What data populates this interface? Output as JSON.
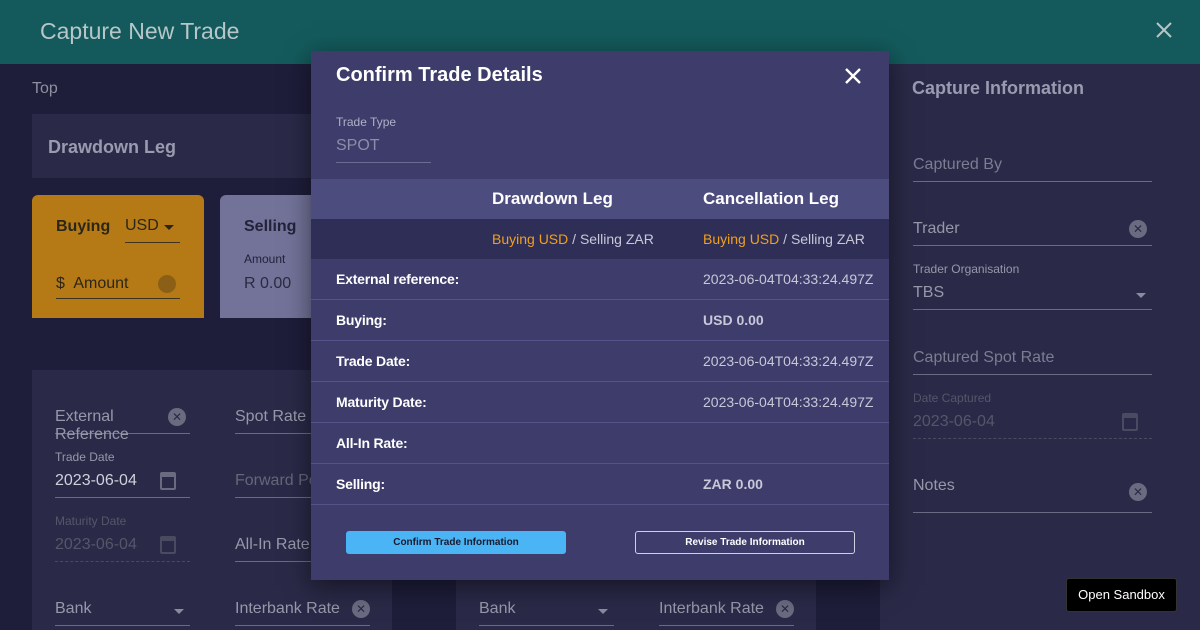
{
  "header": {
    "title": "Capture New Trade"
  },
  "background": {
    "top_label": "Top",
    "drawdown_title": "Drawdown Leg",
    "buy": {
      "label": "Buying",
      "currency": "USD",
      "amount_prefix": "$",
      "amount_placeholder": "Amount"
    },
    "sell": {
      "label": "Selling",
      "amount_label": "Amount",
      "amount_prefix": "R",
      "amount_value": "0.00"
    },
    "form": {
      "external_reference": "External Reference",
      "spot_rate": "Spot Rate",
      "trade_date_label": "Trade Date",
      "trade_date": "2023-06-04",
      "forward_points": "Forward Po",
      "maturity_date_label": "Maturity Date",
      "maturity_date": "2023-06-04",
      "all_in_rate": "All-In Rate",
      "bank": "Bank",
      "interbank_rate": "Interbank Rate",
      "bank2": "Bank",
      "interbank_rate2": "Interbank Rate"
    },
    "capture": {
      "title": "Capture Information",
      "captured_by": "Captured By",
      "trader": "Trader",
      "trader_org_label": "Trader Organisation",
      "trader_org": "TBS",
      "captured_spot_rate": "Captured Spot Rate",
      "date_captured_label": "Date Captured",
      "date_captured": "2023-06-04",
      "notes": "Notes"
    }
  },
  "modal": {
    "title": "Confirm Trade Details",
    "trade_type_label": "Trade Type",
    "trade_type": "SPOT",
    "legs": {
      "drawdown": "Drawdown Leg",
      "cancellation": "Cancellation Leg",
      "drawdown_buy": "Buying USD",
      "drawdown_sep": " / ",
      "drawdown_sell": "Selling ZAR",
      "cancel_buy": "Buying USD",
      "cancel_sep": " / ",
      "cancel_sell": "Selling ZAR"
    },
    "rows": [
      {
        "key": "External reference:",
        "value": "2023-06-04T04:33:24.497Z"
      },
      {
        "key": "Buying:",
        "value": "USD 0.00"
      },
      {
        "key": "Trade Date:",
        "value": "2023-06-04T04:33:24.497Z"
      },
      {
        "key": "Maturity Date:",
        "value": "2023-06-04T04:33:24.497Z"
      },
      {
        "key": "All-In Rate:",
        "value": ""
      },
      {
        "key": "Selling:",
        "value": "ZAR 0.00"
      }
    ],
    "confirm_label": "Confirm Trade Information",
    "revise_label": "Revise Trade Information"
  },
  "sandbox_label": "Open Sandbox",
  "colors": {
    "accent_orange": "#f0a01e",
    "confirm_blue": "#4ab4f5",
    "modal_bg": "#3d3c6b",
    "header_teal": "#145a5c"
  }
}
